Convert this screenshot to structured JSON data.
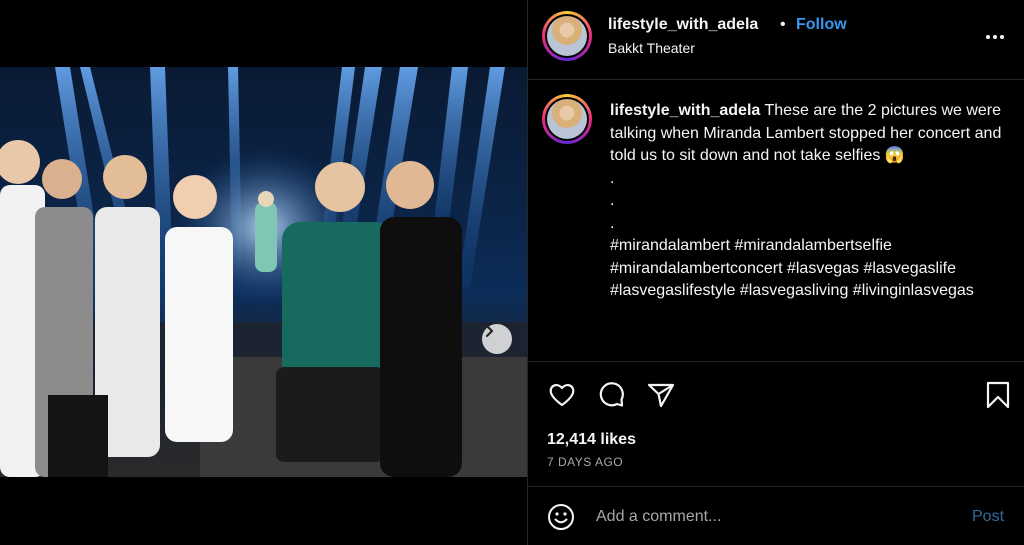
{
  "post": {
    "username": "lifestyle_with_adela",
    "separator": "•",
    "follow_label": "Follow",
    "location": "Bakkt Theater",
    "more_icon": "more-horizontal-icon"
  },
  "media": {
    "next_icon": "chevron-right-icon"
  },
  "caption": {
    "username": "lifestyle_with_adela",
    "text": "These are the 2 pictures we were talking when Miranda Lambert stopped her concert and told us to sit down and not take selfies 😱",
    "dots": [
      ".",
      ".",
      "."
    ],
    "hashtags": "#mirandalambert #mirandalambertselfie #mirandalambertconcert #lasvegas #lasvegaslife #lasvegaslifestyle #lasvegasliving #livinginlasvegas"
  },
  "actions": {
    "icons": [
      "heart-icon",
      "comment-icon",
      "share-icon",
      "bookmark-icon"
    ],
    "likes": "12,414 likes",
    "time_ago": "7 DAYS AGO"
  },
  "comment": {
    "placeholder": "Add a comment...",
    "post_label": "Post",
    "emoji_icon": "emoji-icon"
  },
  "colors": {
    "accent": "#3897f0",
    "post_disabled": "#2f6a9c",
    "divider": "#262626",
    "muted": "#a8a8a8"
  }
}
